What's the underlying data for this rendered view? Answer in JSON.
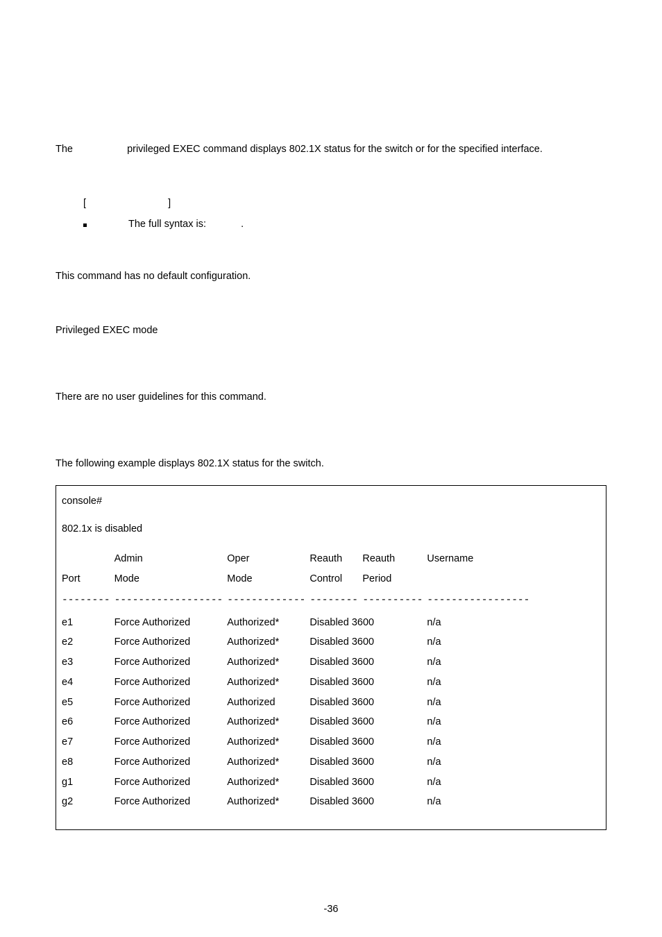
{
  "intro": {
    "pre": "The",
    "post": "privileged EXEC command displays 802.1X status for the switch or for the specified interface."
  },
  "syntax": {
    "lbr": "[",
    "rbr": "]",
    "text": "The full syntax is:",
    "dot": "."
  },
  "default_cfg": "This command has no default configuration.",
  "mode": "Privileged EXEC mode",
  "guidelines": "There are no user guidelines for this command.",
  "example_intro": "The following example displays 802.1X status for the switch.",
  "example": {
    "prompt": "console#",
    "status": "802.1x is disabled",
    "hdr1": {
      "admin": "Admin",
      "oper": "Oper",
      "rc": "Reauth",
      "rp": "Reauth",
      "user": "Username"
    },
    "hdr2": {
      "port": "Port",
      "admin": "Mode",
      "oper": "Mode",
      "rc": "Control",
      "rp": "Period"
    },
    "dashes": {
      "port": "--------",
      "admin": "------------------",
      "oper": "-------------",
      "rc": "--------",
      "rp": "----------",
      "user": "-----------------"
    },
    "rows": [
      {
        "port": "e1",
        "admin": "Force Authorized",
        "oper": "Authorized*",
        "rc": "Disabled",
        "rp": "3600",
        "user": "n/a"
      },
      {
        "port": "e2",
        "admin": "Force Authorized",
        "oper": "Authorized*",
        "rc": "Disabled",
        "rp": "3600",
        "user": "n/a"
      },
      {
        "port": "e3",
        "admin": "Force Authorized",
        "oper": "Authorized*",
        "rc": "Disabled",
        "rp": "3600",
        "user": "n/a"
      },
      {
        "port": "e4",
        "admin": "Force Authorized",
        "oper": "Authorized*",
        "rc": "Disabled",
        "rp": "3600",
        "user": "n/a"
      },
      {
        "port": "e5",
        "admin": "Force Authorized",
        "oper": "Authorized",
        "rc": "Disabled",
        "rp": "3600",
        "user": "n/a"
      },
      {
        "port": "e6",
        "admin": "Force Authorized",
        "oper": "Authorized*",
        "rc": "Disabled",
        "rp": "3600",
        "user": "n/a"
      },
      {
        "port": "e7",
        "admin": "Force Authorized",
        "oper": "Authorized*",
        "rc": "Disabled",
        "rp": "3600",
        "user": "n/a"
      },
      {
        "port": "e8",
        "admin": "Force Authorized",
        "oper": "Authorized*",
        "rc": "Disabled",
        "rp": "3600",
        "user": "n/a"
      },
      {
        "port": "g1",
        "admin": "Force Authorized",
        "oper": "Authorized*",
        "rc": "Disabled",
        "rp": "3600",
        "user": "n/a"
      },
      {
        "port": "g2",
        "admin": "Force Authorized",
        "oper": "Authorized*",
        "rc": "Disabled",
        "rp": "3600",
        "user": "n/a"
      }
    ]
  },
  "page_number": "-36"
}
